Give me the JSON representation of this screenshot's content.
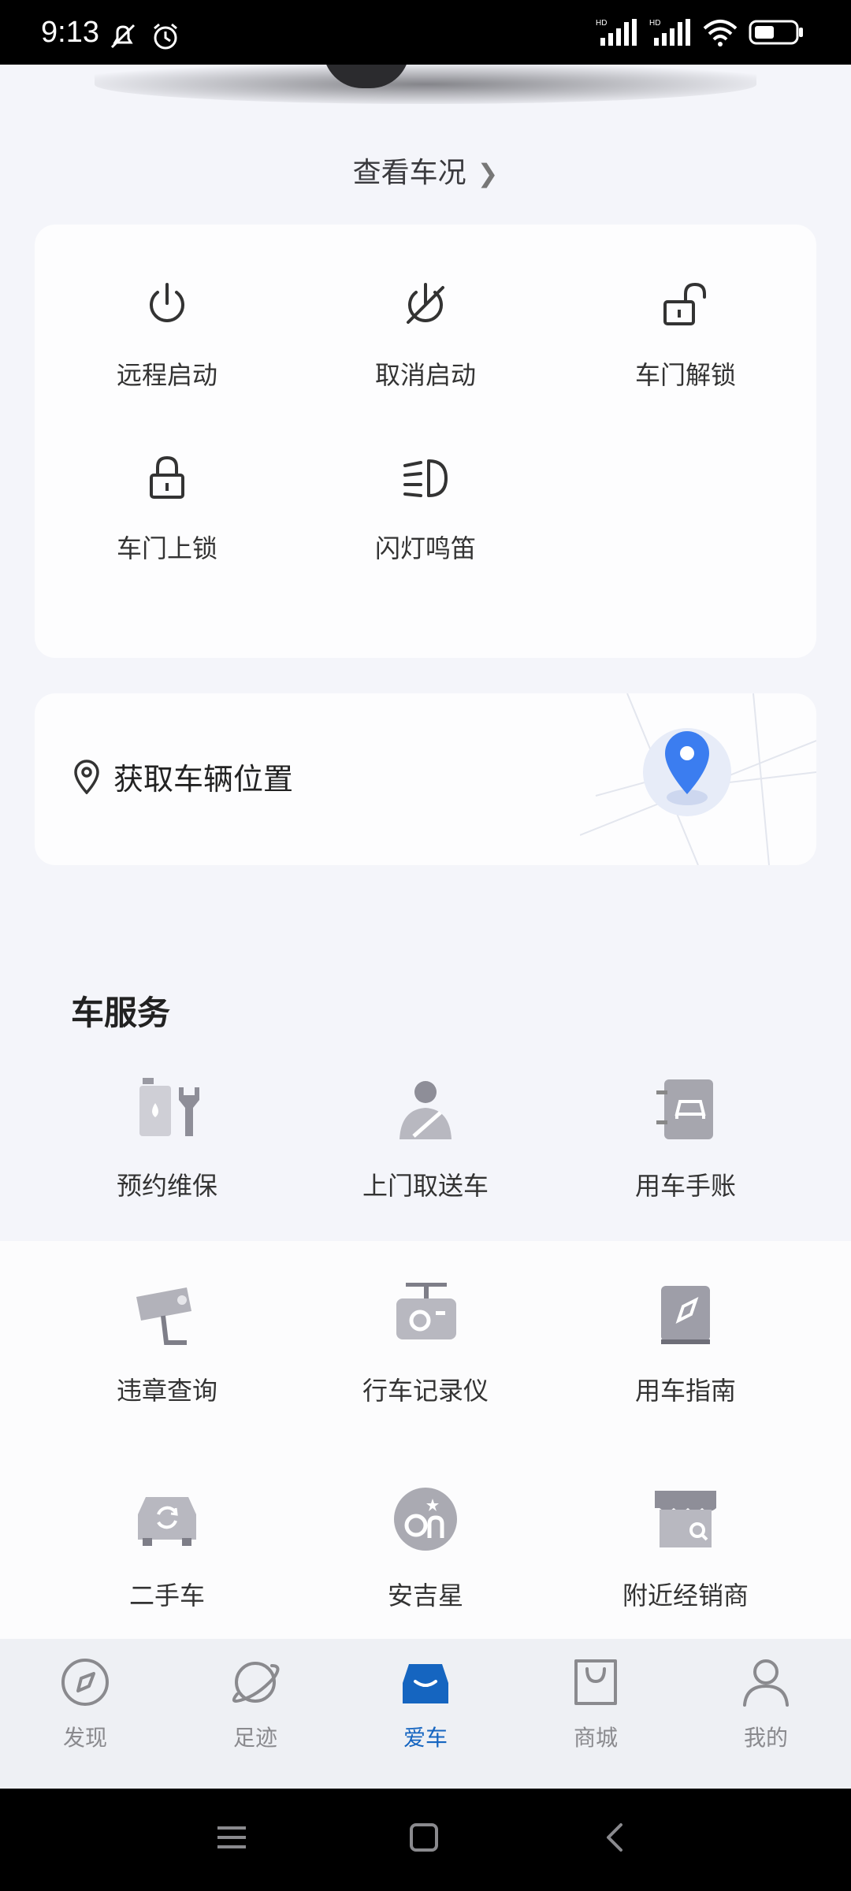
{
  "status_bar": {
    "time": "9:13",
    "signal_labels": [
      "HD",
      "HD"
    ]
  },
  "header": {
    "view_status": "查看车况"
  },
  "controls": [
    {
      "label": "远程启动",
      "icon": "power-icon"
    },
    {
      "label": "取消启动",
      "icon": "power-off-icon"
    },
    {
      "label": "车门解锁",
      "icon": "unlock-icon"
    },
    {
      "label": "车门上锁",
      "icon": "lock-icon"
    },
    {
      "label": "闪灯鸣笛",
      "icon": "headlight-icon"
    }
  ],
  "location": {
    "label": "获取车辆位置"
  },
  "services": {
    "title": "车服务",
    "items": [
      {
        "label": "预约维保",
        "icon": "maintenance-icon"
      },
      {
        "label": "上门取送车",
        "icon": "driver-pickup-icon"
      },
      {
        "label": "用车手账",
        "icon": "car-notebook-icon"
      },
      {
        "label": "违章查询",
        "icon": "traffic-camera-icon"
      },
      {
        "label": "行车记录仪",
        "icon": "dashcam-icon"
      },
      {
        "label": "用车指南",
        "icon": "guide-book-icon"
      },
      {
        "label": "二手车",
        "icon": "used-car-icon"
      },
      {
        "label": "安吉星",
        "icon": "onstar-icon"
      },
      {
        "label": "附近经销商",
        "icon": "dealer-store-icon"
      }
    ]
  },
  "tabbar": {
    "tabs": [
      {
        "label": "发现",
        "icon": "compass-icon",
        "active": false
      },
      {
        "label": "足迹",
        "icon": "planet-icon",
        "active": false
      },
      {
        "label": "爱车",
        "icon": "car-icon",
        "active": true
      },
      {
        "label": "商城",
        "icon": "shopping-bag-icon",
        "active": false
      },
      {
        "label": "我的",
        "icon": "profile-icon",
        "active": false
      }
    ]
  },
  "colors": {
    "accent": "#1565c0",
    "background": "#f4f5fa",
    "text": "#333333"
  }
}
